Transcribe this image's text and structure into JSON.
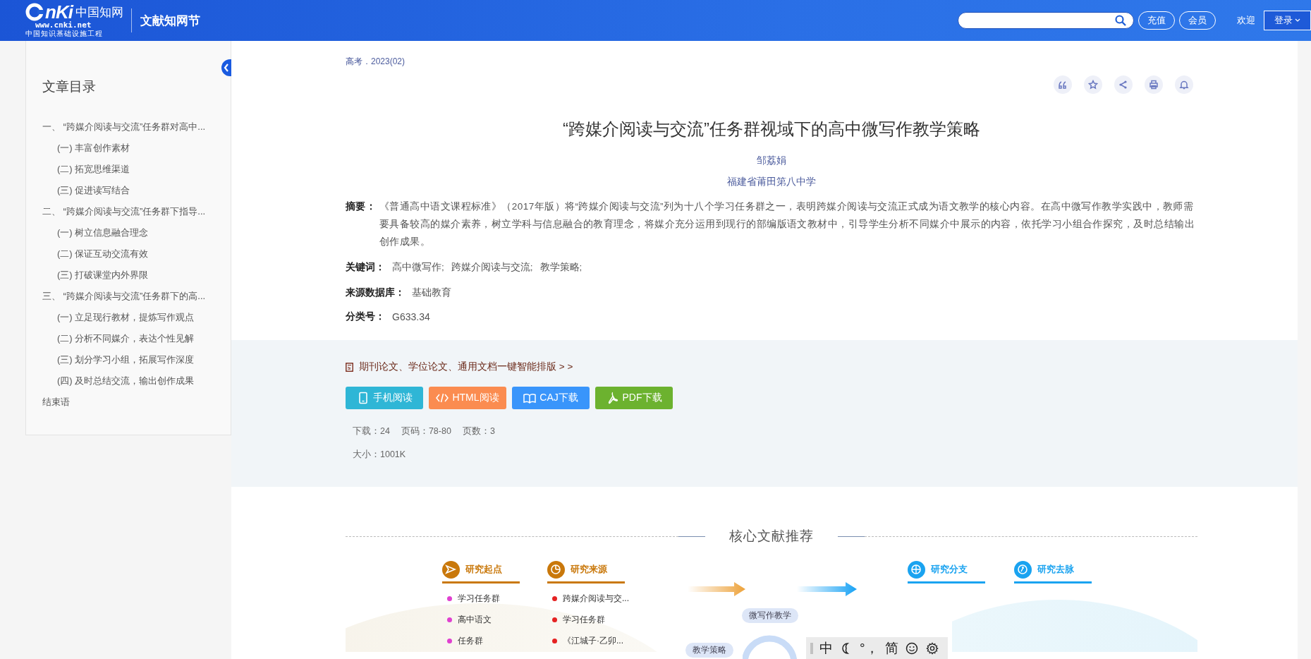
{
  "header": {
    "logo": {
      "mark": "nKi",
      "brand": "中国知网",
      "url": "www.cnki.net",
      "tagline": "中国知识基础设施工程"
    },
    "section_title": "文献知网节",
    "buttons": [
      "充值",
      "会员"
    ],
    "welcome": "欢迎",
    "login": "登录"
  },
  "toc": {
    "title": "文章目录",
    "items": [
      {
        "label": "一、 “跨媒介阅读与交流”任务群对高中...",
        "children": [
          {
            "label": "(一) 丰富创作素材"
          },
          {
            "label": "(二) 拓宽思维渠道"
          },
          {
            "label": "(三) 促进读写结合"
          }
        ]
      },
      {
        "label": "二、 “跨媒介阅读与交流”任务群下指导...",
        "children": [
          {
            "label": "(一) 树立信息融合理念"
          },
          {
            "label": "(二) 保证互动交流有效"
          },
          {
            "label": "(三) 打破课堂内外界限"
          }
        ]
      },
      {
        "label": "三、 “跨媒介阅读与交流”任务群下的高...",
        "children": [
          {
            "label": "(一) 立足现行教材，提炼写作观点"
          },
          {
            "label": "(二) 分析不同媒介，表达个性见解"
          },
          {
            "label": "(三) 划分学习小组，拓展写作深度"
          },
          {
            "label": "(四) 及时总结交流，输出创作成果"
          }
        ]
      },
      {
        "label": "结束语"
      }
    ]
  },
  "article": {
    "source": "高考．2023(02)",
    "title": "“跨媒介阅读与交流”任务群视域下的高中微写作教学策略",
    "authors": [
      "邹荔娟"
    ],
    "affiliations": [
      "福建省莆田第八中学"
    ],
    "abstract": {
      "label": "摘要：",
      "text": "《普通高中语文课程标准》（2017年版）将“跨媒介阅读与交流”列为十八个学习任务群之一，表明跨媒介阅读与交流正式成为语文教学的核心内容。在高中微写作教学实践中，教师需要具备较高的媒介素养，树立学科与信息融合的教育理念，将媒介充分运用到现行的部编版语文教材中，引导学生分析不同媒介中展示的内容，依托学习小组合作探究，及时总结输出创作成果。"
    },
    "keywords": {
      "label": "关键词：",
      "items": [
        "高中微写作;",
        "跨媒介阅读与交流;",
        "教学策略;"
      ]
    },
    "database": {
      "label": "来源数据库：",
      "value": "基础教育"
    },
    "classification": {
      "label": "分类号：",
      "value": "G633.34"
    }
  },
  "downloads": {
    "promo": "期刊论文、学位论文、通用文档一键智能排版 > >",
    "buttons": [
      {
        "kind": "mobile",
        "label": "手机阅读"
      },
      {
        "kind": "html",
        "label": "HTML阅读"
      },
      {
        "kind": "caj",
        "label": "CAJ下载"
      },
      {
        "kind": "pdf",
        "label": "PDF下载"
      }
    ],
    "stats": [
      [
        "下载：24",
        "页码：78-80",
        "页数：3"
      ],
      [
        "大小：1001K"
      ]
    ]
  },
  "recommend": {
    "title": "核心文献推荐",
    "groups": [
      {
        "kind": "origin",
        "label": "研究起点",
        "items": [
          "学习任务群",
          "高中语文",
          "任务群"
        ]
      },
      {
        "kind": "source",
        "label": "研究来源",
        "items": [
          "跨媒介阅读与交...",
          "学习任务群",
          "《江城子·乙卯..."
        ]
      },
      {
        "kind": "branch",
        "label": "研究分支"
      },
      {
        "kind": "trend",
        "label": "研究去脉"
      }
    ],
    "bubbles": [
      "微写作教学",
      "教学策略"
    ]
  },
  "ime": {
    "items": [
      {
        "kind": "text",
        "label": "中"
      },
      {
        "kind": "moon"
      },
      {
        "kind": "text",
        "label": "°，"
      },
      {
        "kind": "text",
        "label": "简"
      },
      {
        "kind": "smiley"
      },
      {
        "kind": "gear"
      }
    ]
  }
}
